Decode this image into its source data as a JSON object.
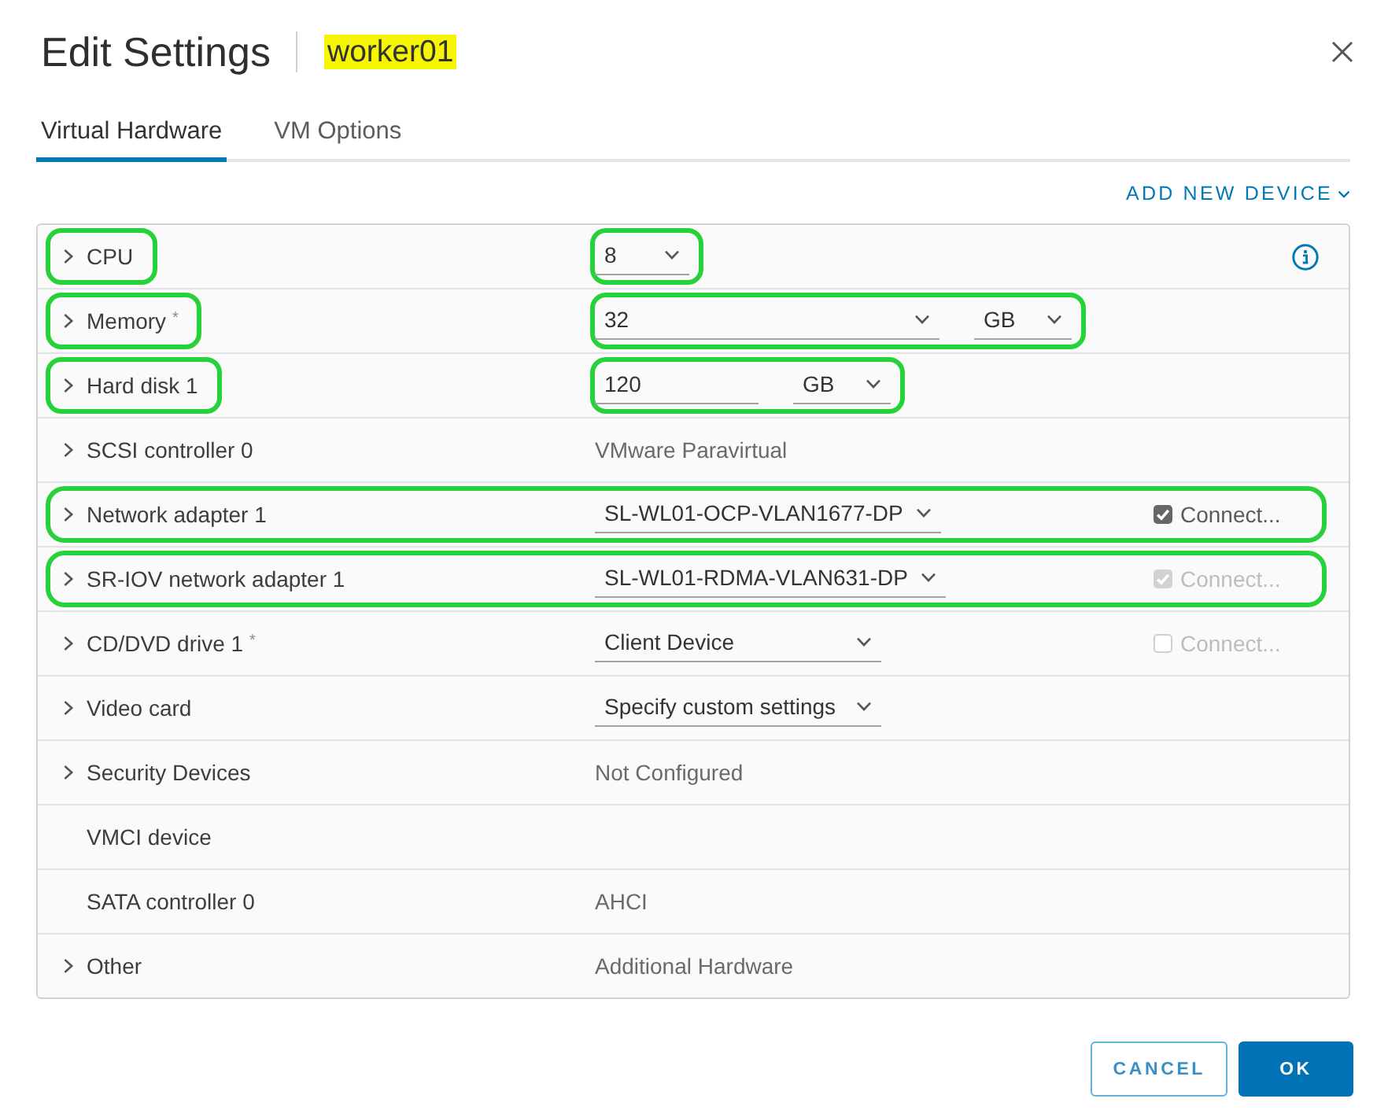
{
  "dialog": {
    "title": "Edit Settings",
    "vm_name": "worker01",
    "vm_name_highlighted": true
  },
  "tabs": [
    {
      "label": "Virtual Hardware",
      "selected": true
    },
    {
      "label": "VM Options",
      "selected": false
    }
  ],
  "add_device": {
    "label": "ADD NEW DEVICE"
  },
  "devices": [
    {
      "label": "CPU",
      "expandable": true,
      "label_outlined": true,
      "value_outlined": true,
      "kind": "count",
      "value": "8",
      "info": true
    },
    {
      "label": "Memory $^{*}$",
      "expandable": true,
      "label_outlined": true,
      "value_outlined": true,
      "kind": "size",
      "value": "32",
      "value_dropdown": true,
      "unit": "GB"
    },
    {
      "label": "Hard disk 1",
      "expandable": true,
      "label_outlined": true,
      "value_outlined": true,
      "kind": "size",
      "value": "120",
      "value_dropdown": false,
      "unit": "GB"
    },
    {
      "label": "SCSI controller 0",
      "expandable": true,
      "kind": "text",
      "value": "VMware Paravirtual"
    },
    {
      "label": "Network adapter 1",
      "expandable": true,
      "row_outlined": true,
      "kind": "select",
      "value": "SL-WL01-OCP-VLAN1677-DP",
      "connect": {
        "label": "Connect...",
        "checked": true,
        "disabled": false
      }
    },
    {
      "label": "SR-IOV network adapter 1",
      "expandable": true,
      "row_outlined": true,
      "kind": "select",
      "value": "SL-WL01-RDMA-VLAN631-DP",
      "connect": {
        "label": "Connect...",
        "checked": true,
        "disabled": true
      }
    },
    {
      "label": "CD/DVD drive 1 $^{*}$",
      "expandable": true,
      "kind": "select",
      "value": "Client Device",
      "connect": {
        "label": "Connect...",
        "checked": false,
        "disabled": true
      }
    },
    {
      "label": "Video card",
      "expandable": true,
      "kind": "select",
      "value": "Specify custom settings"
    },
    {
      "label": "Security Devices",
      "expandable": true,
      "kind": "text",
      "value": "Not Configured"
    },
    {
      "label": "VMCI device",
      "expandable": false,
      "kind": "none"
    },
    {
      "label": "SATA controller 0",
      "expandable": false,
      "kind": "text",
      "value": "AHCI"
    },
    {
      "label": "Other",
      "expandable": true,
      "kind": "text",
      "value": "Additional Hardware"
    }
  ],
  "buttons": [
    {
      "label": "CANCEL",
      "kind": "secondary"
    },
    {
      "label": "OK",
      "kind": "primary"
    }
  ]
}
